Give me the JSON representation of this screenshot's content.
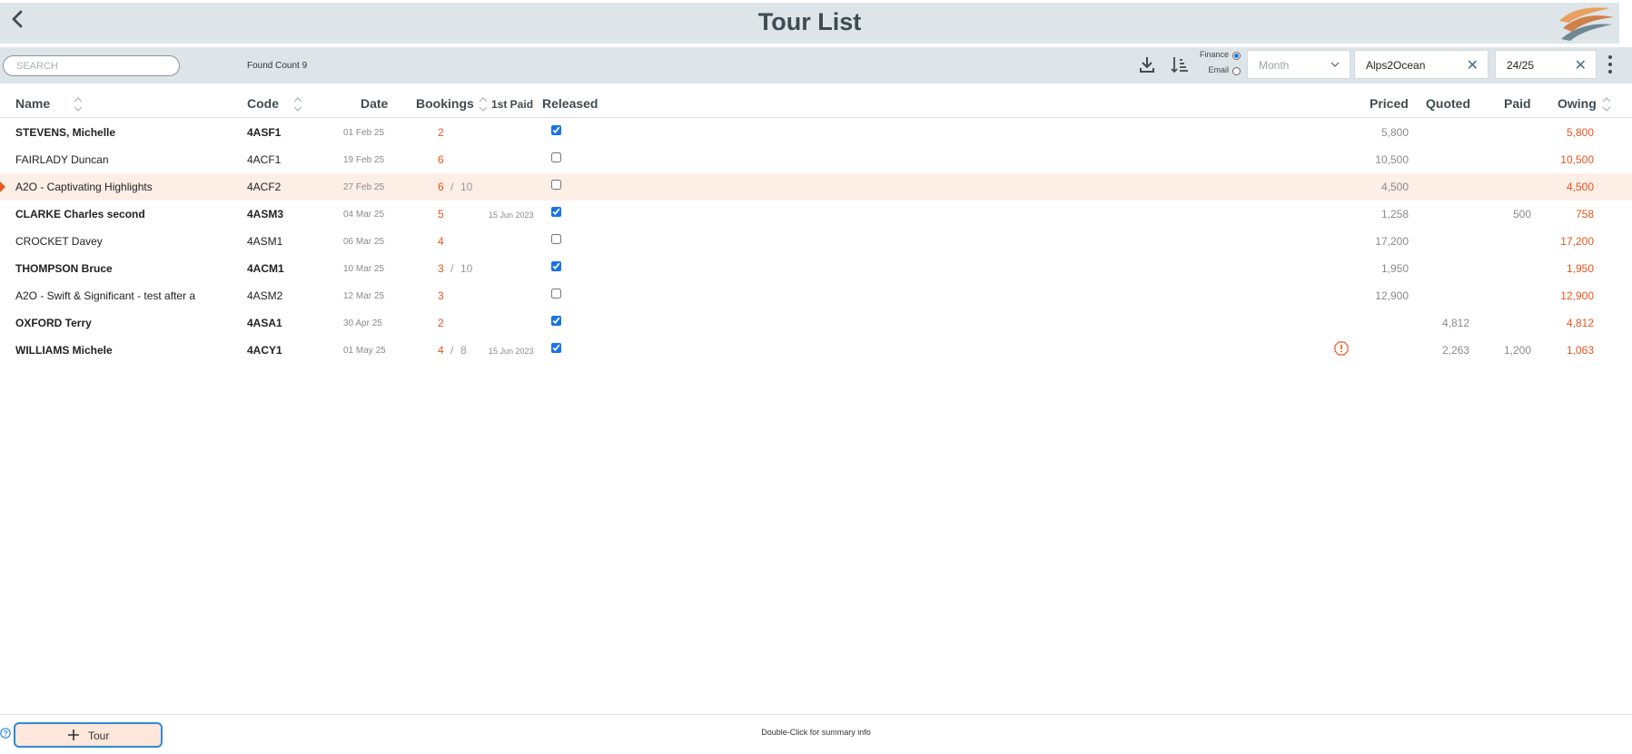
{
  "header": {
    "title": "Tour List"
  },
  "toolbar": {
    "search_placeholder": "SEARCH",
    "found_count": "Found Count 9",
    "radio_finance_label": "Finance",
    "radio_email_label": "Email",
    "radio_selected": "Finance",
    "month_placeholder": "Month",
    "company_value": "Alps2Ocean",
    "season_value": "24/25"
  },
  "columns": {
    "name": "Name",
    "code": "Code",
    "date": "Date",
    "bookings": "Bookings",
    "first_paid": "1st Paid",
    "released": "Released",
    "priced": "Priced",
    "quoted": "Quoted",
    "paid": "Paid",
    "owing": "Owing"
  },
  "rows": [
    {
      "name": "STEVENS, Michelle",
      "bold": true,
      "code": "4ASF1",
      "date": "01 Feb 25",
      "bookings": "2",
      "capacity": "",
      "first_paid": "",
      "released": true,
      "warning": false,
      "priced": "5,800",
      "quoted": "",
      "paid": "",
      "owing": "5,800",
      "selected": false
    },
    {
      "name": "FAIRLADY Duncan",
      "bold": false,
      "code": "4ACF1",
      "date": "19 Feb 25",
      "bookings": "6",
      "capacity": "",
      "first_paid": "",
      "released": false,
      "warning": false,
      "priced": "10,500",
      "quoted": "",
      "paid": "",
      "owing": "10,500",
      "selected": false
    },
    {
      "name": "A2O - Captivating Highlights",
      "bold": false,
      "code": "4ACF2",
      "date": "27 Feb 25",
      "bookings": "6",
      "capacity": "10",
      "first_paid": "",
      "released": false,
      "warning": false,
      "priced": "4,500",
      "quoted": "",
      "paid": "",
      "owing": "4,500",
      "selected": true
    },
    {
      "name": "CLARKE Charles second",
      "bold": true,
      "code": "4ASM3",
      "date": "04 Mar 25",
      "bookings": "5",
      "capacity": "",
      "first_paid": "15 Jun 2023",
      "released": true,
      "warning": false,
      "priced": "1,258",
      "quoted": "",
      "paid": "500",
      "owing": "758",
      "selected": false
    },
    {
      "name": "CROCKET Davey",
      "bold": false,
      "code": "4ASM1",
      "date": "06 Mar 25",
      "bookings": "4",
      "capacity": "",
      "first_paid": "",
      "released": false,
      "warning": false,
      "priced": "17,200",
      "quoted": "",
      "paid": "",
      "owing": "17,200",
      "selected": false
    },
    {
      "name": "THOMPSON Bruce",
      "bold": true,
      "code": "4ACM1",
      "date": "10 Mar 25",
      "bookings": "3",
      "capacity": "10",
      "first_paid": "",
      "released": true,
      "warning": false,
      "priced": "1,950",
      "quoted": "",
      "paid": "",
      "owing": "1,950",
      "selected": false
    },
    {
      "name": "A2O - Swift & Significant - test after a",
      "bold": false,
      "code": "4ASM2",
      "date": "12 Mar 25",
      "bookings": "3",
      "capacity": "",
      "first_paid": "",
      "released": false,
      "warning": false,
      "priced": "12,900",
      "quoted": "",
      "paid": "",
      "owing": "12,900",
      "selected": false
    },
    {
      "name": "OXFORD Terry",
      "bold": true,
      "code": "4ASA1",
      "date": "30 Apr 25",
      "bookings": "2",
      "capacity": "",
      "first_paid": "",
      "released": true,
      "warning": false,
      "priced": "",
      "quoted": "4,812",
      "paid": "",
      "owing": "4,812",
      "selected": false
    },
    {
      "name": "WILLIAMS Michele",
      "bold": true,
      "code": "4ACY1",
      "date": "01 May 25",
      "bookings": "4",
      "capacity": "8",
      "first_paid": "15 Jun 2023",
      "released": true,
      "warning": true,
      "priced": "",
      "quoted": "2,263",
      "paid": "1,200",
      "owing": "1,063",
      "selected": false
    }
  ],
  "footer": {
    "add_button_label": "Tour",
    "hint": "Double-Click for summary info"
  },
  "colors": {
    "accent": "#e8531a",
    "header_bg": "#dde5e8",
    "selected_row": "#fdeee6",
    "button_border": "#2d8bd8"
  }
}
